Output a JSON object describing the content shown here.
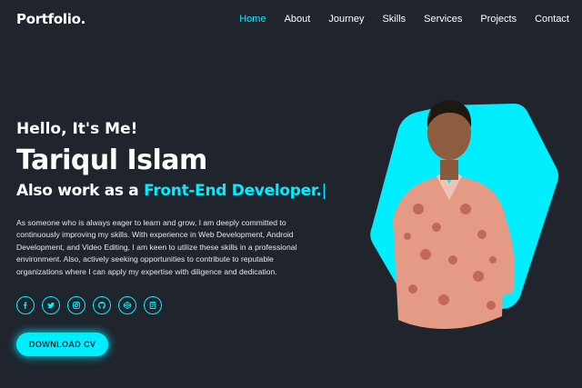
{
  "header": {
    "logo": "Portfolio.",
    "nav": [
      {
        "label": "Home",
        "active": true
      },
      {
        "label": "About",
        "active": false
      },
      {
        "label": "Journey",
        "active": false
      },
      {
        "label": "Skills",
        "active": false
      },
      {
        "label": "Services",
        "active": false
      },
      {
        "label": "Projects",
        "active": false
      },
      {
        "label": "Contact",
        "active": false
      }
    ]
  },
  "home": {
    "greeting": "Hello, It's Me!",
    "name": "Tariqul Islam",
    "role_prefix": "Also work as a ",
    "role_highlight": "Front-End Developer.",
    "role_cursor": "|",
    "description": "As someone who is always eager to learn and grow, I am deeply committed to continuously improving my skills. With experience in Web Development, Android Development, and Video Editing, I am keen to utilize these skills in a professional environment. Also, actively seeking opportunities to contribute to reputable organizations where I can apply my expertise with diligence and dedication.",
    "socials": [
      {
        "icon": "facebook-icon"
      },
      {
        "icon": "twitter-icon"
      },
      {
        "icon": "instagram-icon"
      },
      {
        "icon": "github-icon"
      },
      {
        "icon": "codepen-icon"
      },
      {
        "icon": "blog-icon"
      }
    ],
    "cv_button": "DOWNLOAD CV"
  },
  "colors": {
    "background": "#1f242d",
    "accent": "#00eeff",
    "text": "#ffffff"
  }
}
